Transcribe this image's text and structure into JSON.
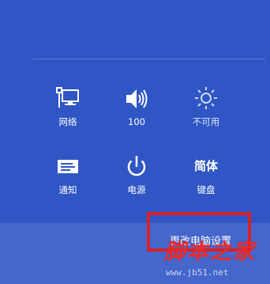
{
  "quick_settings": [
    {
      "label": "网络",
      "icon": "network-icon"
    },
    {
      "label": "100",
      "icon": "volume-icon"
    },
    {
      "label": "不可用",
      "icon": "brightness-icon"
    },
    {
      "label": "通知",
      "icon": "notifications-icon"
    },
    {
      "label": "电源",
      "icon": "power-icon"
    },
    {
      "label": "键盘",
      "icon": "keyboard-ime-icon",
      "icon_text": "简体"
    }
  ],
  "footer": {
    "change_settings_label": "更改电脑设置"
  },
  "watermark": {
    "title": "脚本之家",
    "url": "www.jb51.net"
  },
  "colors": {
    "panel_background": "#2f56c4",
    "bottom_bar": "#4566cb",
    "highlight": "#d9202a",
    "watermark": "#e82b2b"
  }
}
